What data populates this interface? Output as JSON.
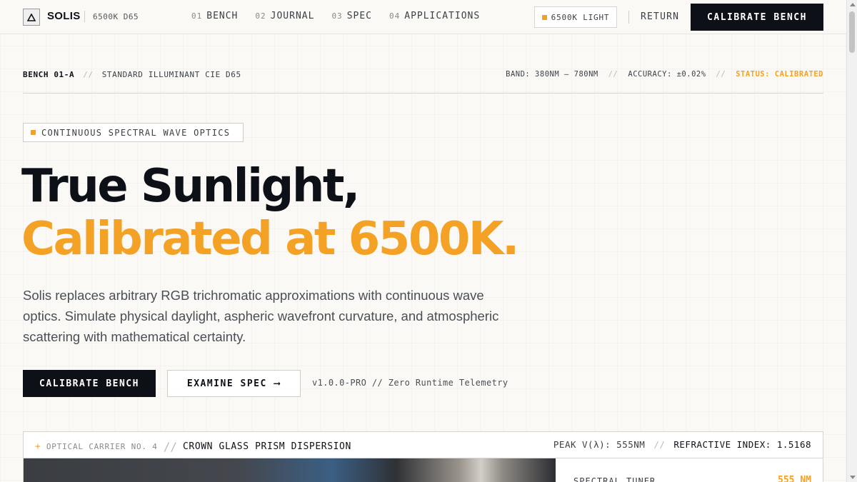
{
  "nav": {
    "logo_icon": "triangle-icon",
    "brand": "SOLIS",
    "brand_tag": "6500K D65",
    "links": [
      {
        "num": "01",
        "label": "BENCH"
      },
      {
        "num": "02",
        "label": "JOURNAL"
      },
      {
        "num": "03",
        "label": "SPEC"
      },
      {
        "num": "04",
        "label": "APPLICATIONS"
      }
    ],
    "light_badge": "6500K LIGHT",
    "return": "RETURN",
    "cta": "CALIBRATE BENCH"
  },
  "bench": {
    "id": "BENCH 01-A",
    "sep": "//",
    "standard": "STANDARD ILLUMINANT CIE D65",
    "band": "BAND: 380NM – 780NM",
    "accuracy": "ACCURACY: ±0.02%",
    "status": "STATUS: CALIBRATED"
  },
  "hero": {
    "tag": "CONTINUOUS SPECTRAL WAVE OPTICS",
    "title_line1": "True Sunlight,",
    "title_line2": "Calibrated at 6500K.",
    "lede": "Solis replaces arbitrary RGB trichromatic approximations with continuous wave optics. Simulate physical daylight, aspheric wavefront curvature, and atmospheric scattering with mathematical certainty.",
    "primary": "CALIBRATE BENCH",
    "secondary": "EXAMINE SPEC",
    "secondary_arrow": "⟶",
    "version": "v1.0.0-PRO // Zero Runtime Telemetry"
  },
  "panel": {
    "plus": "+",
    "carrier_no": "OPTICAL CARRIER NO. 4",
    "sep": "//",
    "carrier_name": "CROWN GLASS PRISM DISPERSION",
    "peak": "PEAK V(λ): 555NM",
    "refractive": "REFRACTIVE INDEX: 1.5168",
    "side_label": "SPECTRAL TUNER",
    "side_value": "555 NM"
  },
  "colors": {
    "accent": "#f4a225",
    "ink": "#0d1117",
    "paper": "#faf9f6"
  }
}
